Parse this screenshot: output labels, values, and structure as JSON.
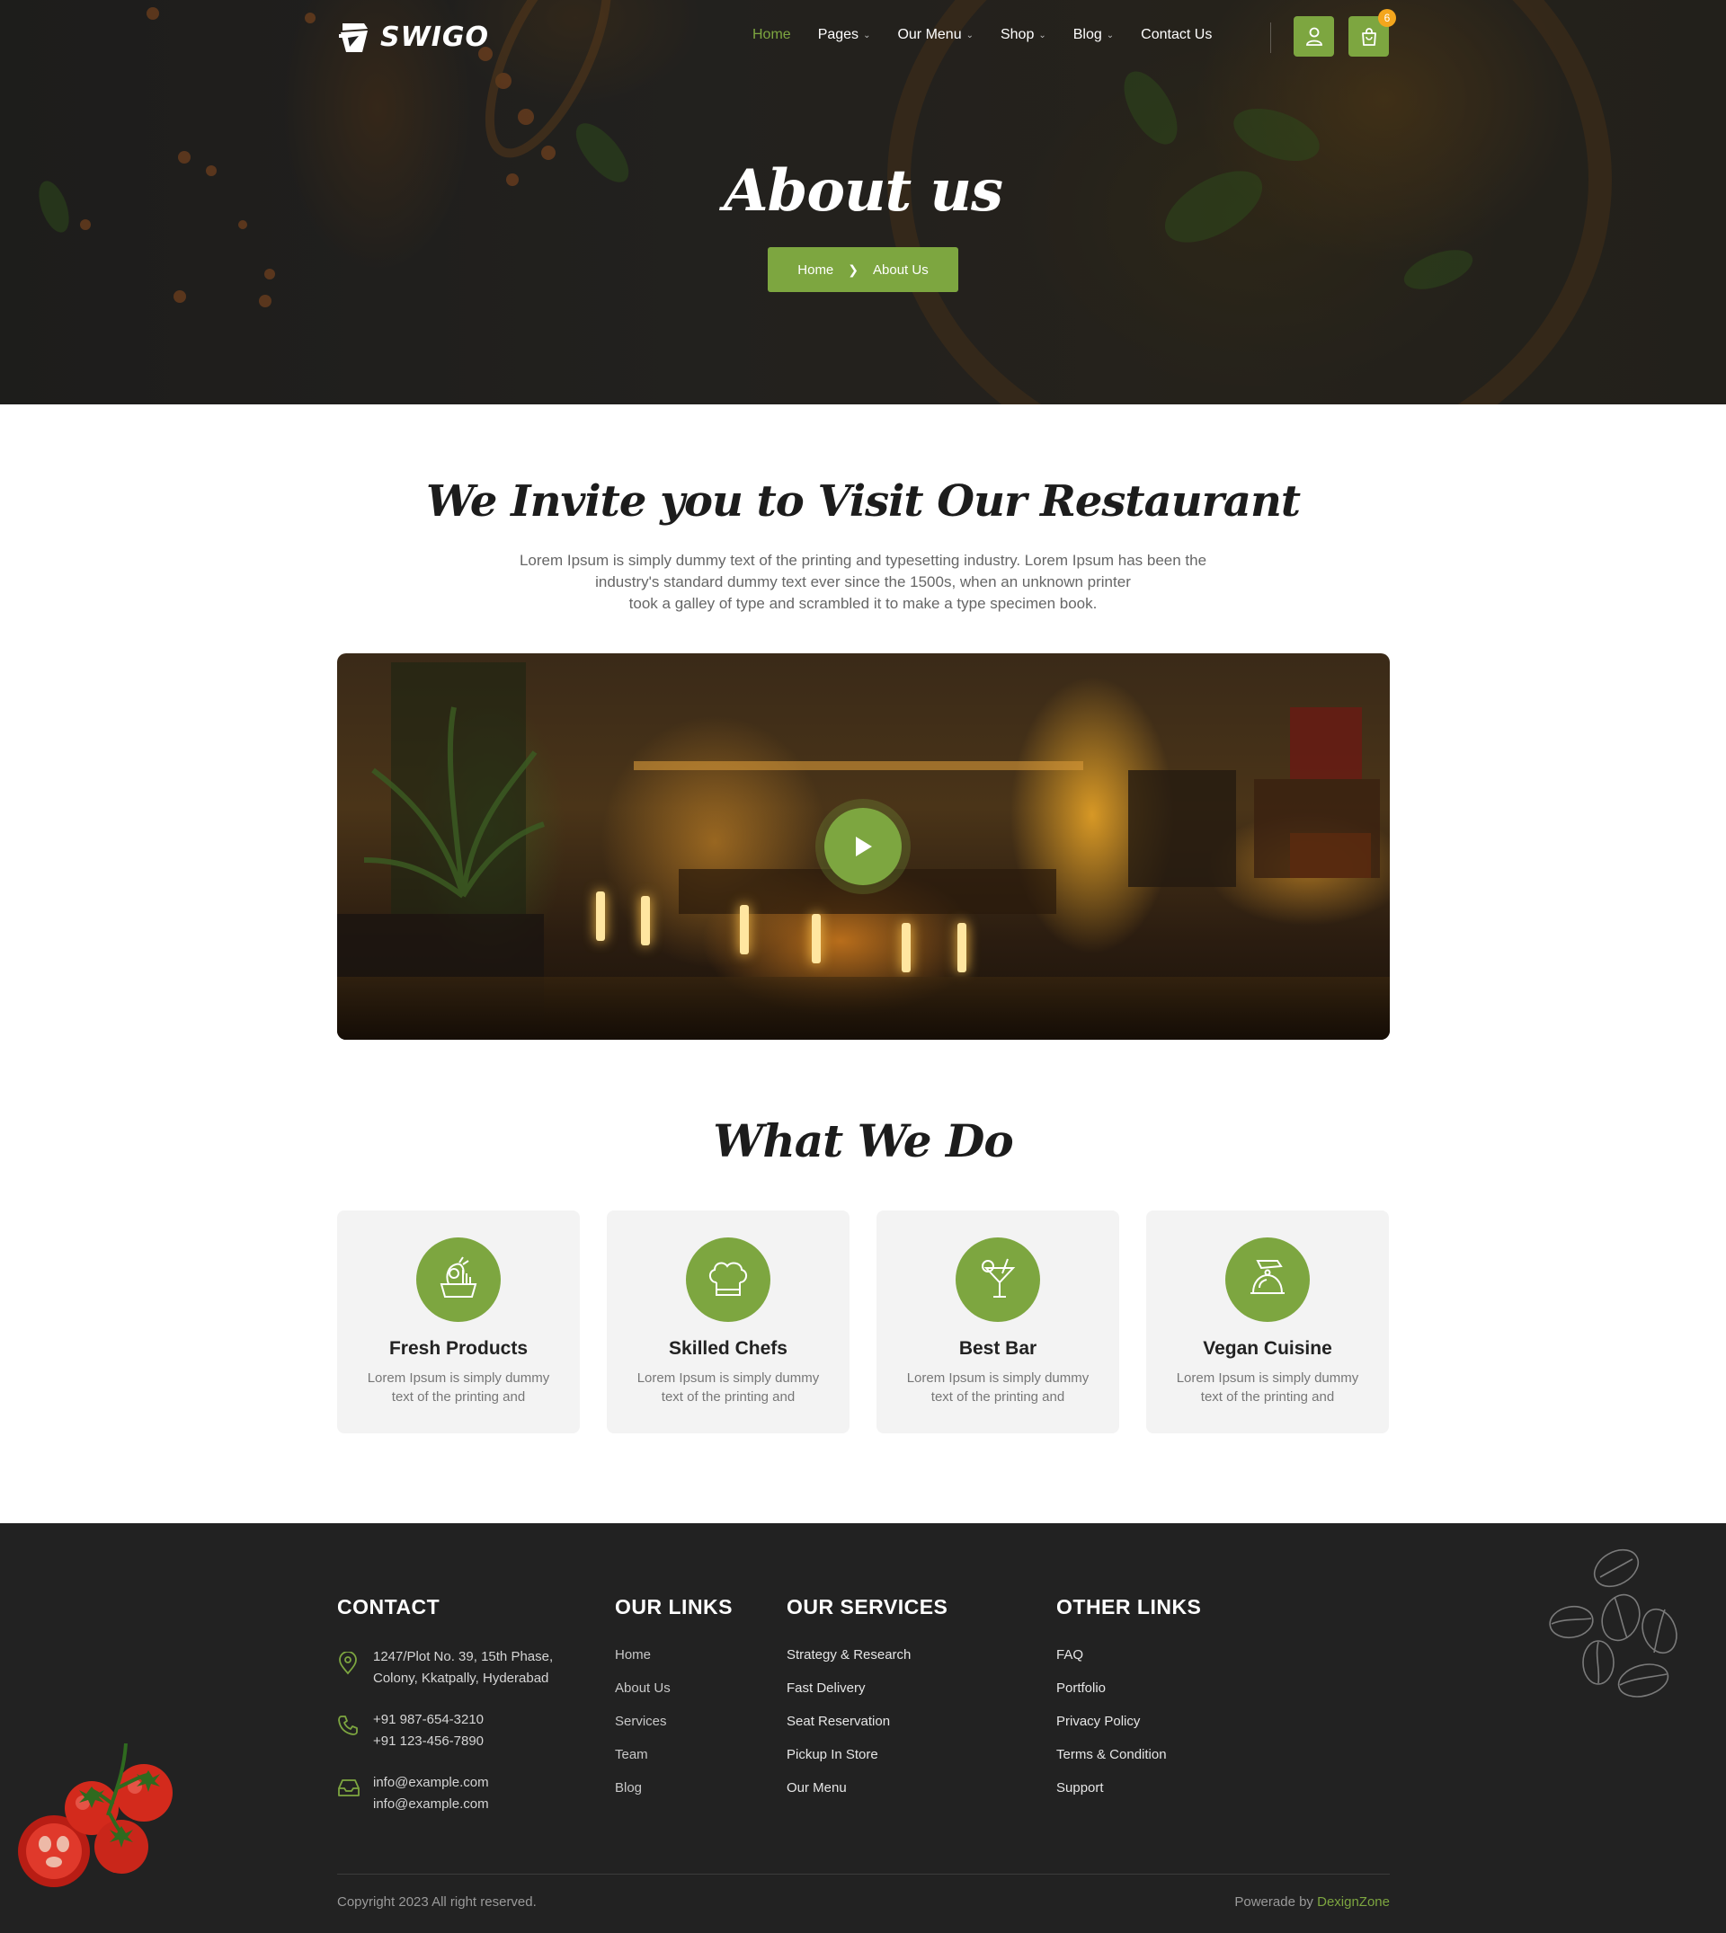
{
  "brand": {
    "name": "SWIGO",
    "accent": "#7da640",
    "badge_color": "#f4a61d"
  },
  "nav": {
    "items": [
      {
        "label": "Home",
        "active": true,
        "dropdown": false
      },
      {
        "label": "Pages",
        "active": false,
        "dropdown": true
      },
      {
        "label": "Our Menu",
        "active": false,
        "dropdown": true
      },
      {
        "label": "Shop",
        "active": false,
        "dropdown": true
      },
      {
        "label": "Blog",
        "active": false,
        "dropdown": true
      },
      {
        "label": "Contact Us",
        "active": false,
        "dropdown": false
      }
    ],
    "user_icon": "user-icon",
    "cart_icon": "shopping-bag-icon",
    "cart_count": "6"
  },
  "hero": {
    "title": "About us",
    "breadcrumb": {
      "home": "Home",
      "current": "About Us"
    }
  },
  "intro": {
    "title": "We Invite you to Visit Our Restaurant",
    "line1": "Lorem Ipsum is simply dummy text of the printing and typesetting industry. Lorem Ipsum has been the",
    "line2": "industry's standard dummy text ever since the 1500s, when an unknown printer",
    "line3": "took a galley of type and scrambled it to make a type specimen book."
  },
  "video": {
    "play_icon": "play-icon"
  },
  "what_we_do": {
    "title": "What We Do",
    "cards": [
      {
        "icon": "vegetables-icon",
        "title": "Fresh Products",
        "text": "Lorem Ipsum is simply dummy text of the printing and"
      },
      {
        "icon": "chef-hat-icon",
        "title": "Skilled Chefs",
        "text": "Lorem Ipsum is simply dummy text of the printing and"
      },
      {
        "icon": "cocktail-icon",
        "title": "Best Bar",
        "text": "Lorem Ipsum is simply dummy text of the printing and"
      },
      {
        "icon": "cloche-icon",
        "title": "Vegan Cuisine",
        "text": "Lorem Ipsum is simply dummy text of the printing and"
      }
    ]
  },
  "footer": {
    "contact": {
      "title": "CONTACT",
      "address_1": "1247/Plot No. 39, 15th Phase,",
      "address_2": "Colony, Kkatpally, Hyderabad",
      "phone_1": "+91 987-654-3210",
      "phone_2": "+91 123-456-7890",
      "email_1": "info@example.com",
      "email_2": "info@example.com"
    },
    "our_links": {
      "title": "OUR LINKS",
      "items": [
        "Home",
        "About Us",
        "Services",
        "Team",
        "Blog"
      ]
    },
    "our_services": {
      "title": "OUR SERVICES",
      "items": [
        "Strategy & Research",
        "Fast Delivery",
        "Seat Reservation",
        "Pickup In Store",
        "Our Menu"
      ]
    },
    "other_links": {
      "title": "OTHER LINKS",
      "items": [
        "FAQ",
        "Portfolio",
        "Privacy Policy",
        "Terms & Condition",
        "Support"
      ]
    },
    "copyright": "Copyright 2023 All right reserved.",
    "powered_prefix": "Powerade by",
    "powered_brand": "DexignZone"
  }
}
